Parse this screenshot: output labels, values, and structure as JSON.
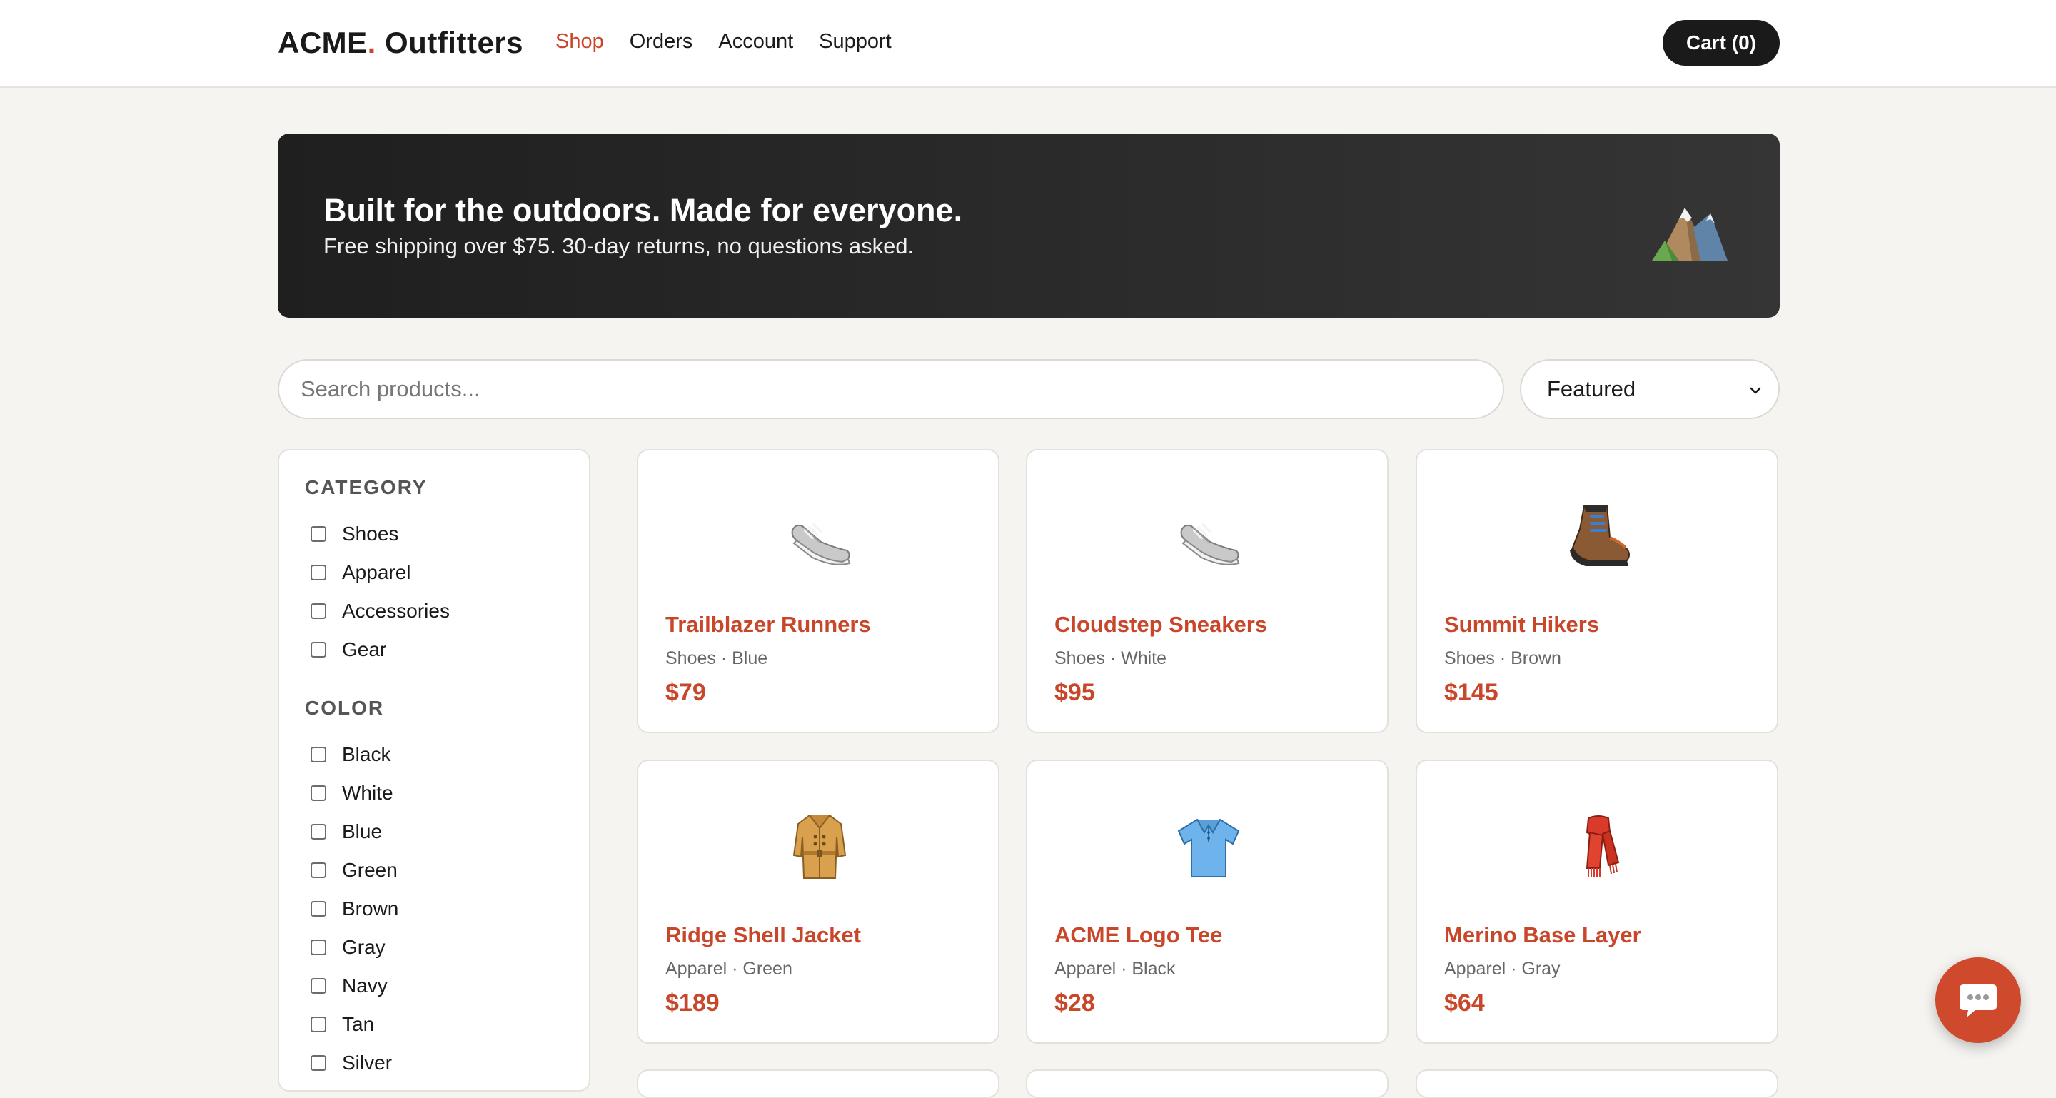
{
  "header": {
    "brand_name": "ACME",
    "brand_dot": ".",
    "brand_suffix": " Outfitters",
    "nav": [
      "Shop",
      "Orders",
      "Account",
      "Support"
    ],
    "active_nav": "Shop",
    "cart_label": "Cart (0)"
  },
  "hero": {
    "title": "Built for the outdoors. Made for everyone.",
    "subtitle": "Free shipping over $75. 30-day returns, no questions asked.",
    "icon": "mountain-icon"
  },
  "search": {
    "placeholder": "Search products...",
    "value": ""
  },
  "sort": {
    "selected": "Featured"
  },
  "filters": {
    "category_title": "CATEGORY",
    "categories": [
      "Shoes",
      "Apparel",
      "Accessories",
      "Gear"
    ],
    "color_title": "COLOR",
    "colors": [
      "Black",
      "White",
      "Blue",
      "Green",
      "Brown",
      "Gray",
      "Navy",
      "Tan",
      "Silver"
    ]
  },
  "products": [
    {
      "name": "Trailblazer Runners",
      "meta": "Shoes · Blue",
      "price": "$79",
      "icon": "running-shoe-icon"
    },
    {
      "name": "Cloudstep Sneakers",
      "meta": "Shoes · White",
      "price": "$95",
      "icon": "running-shoe-icon"
    },
    {
      "name": "Summit Hikers",
      "meta": "Shoes · Brown",
      "price": "$145",
      "icon": "hiking-boot-icon"
    },
    {
      "name": "Ridge Shell Jacket",
      "meta": "Apparel · Green",
      "price": "$189",
      "icon": "coat-icon"
    },
    {
      "name": "ACME Logo Tee",
      "meta": "Apparel · Black",
      "price": "$28",
      "icon": "shirt-icon"
    },
    {
      "name": "Merino Base Layer",
      "meta": "Apparel · Gray",
      "price": "$64",
      "icon": "scarf-icon"
    }
  ],
  "colors": {
    "accent": "#c8472a",
    "dark": "#1a1a1a",
    "background": "#f5f4f1"
  },
  "chat": {
    "icon": "chat-bubble-icon"
  }
}
